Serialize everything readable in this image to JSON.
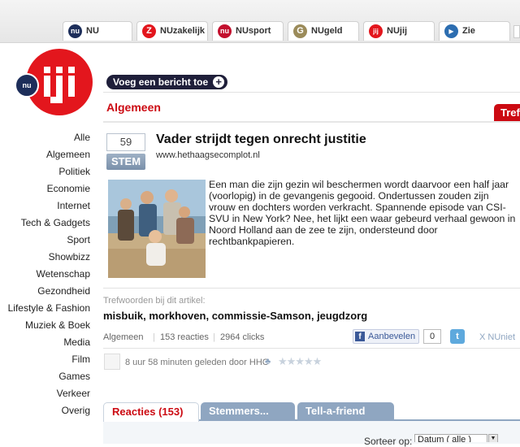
{
  "tabs": [
    {
      "label": "NU",
      "icon": "nu-icon",
      "color": "#1d2e5a",
      "glyph": "nu"
    },
    {
      "label": "NUzakelijk",
      "icon": "z-icon",
      "color": "#e3161d",
      "glyph": "Z"
    },
    {
      "label": "NUsport",
      "icon": "nu-icon",
      "color": "#c3102e",
      "glyph": "nu"
    },
    {
      "label": "NUgeld",
      "icon": "g-icon",
      "color": "#9b8b5a",
      "glyph": "G"
    },
    {
      "label": "NUjij",
      "icon": "jij-icon",
      "color": "#e3161d",
      "glyph": "jij"
    },
    {
      "label": "Zie",
      "icon": "play-icon",
      "color": "#2c6db0",
      "glyph": "▶"
    }
  ],
  "logo": {
    "small": "nu",
    "big": "jij"
  },
  "sidebar": [
    "Alle",
    "Algemeen",
    "Politiek",
    "Economie",
    "Internet",
    "Tech & Gadgets",
    "Sport",
    "Showbizz",
    "Wetenschap",
    "Gezondheid",
    "Lifestyle & Fashion",
    "Muziek & Boek",
    "Media",
    "Film",
    "Games",
    "Verkeer",
    "Overig"
  ],
  "add_button": "Voeg een bericht toe",
  "add_plus": "+",
  "section_title": "Algemeen",
  "tref_tab": "Tref",
  "vote_count": "59",
  "vote_label": "STEM",
  "article": {
    "title": "Vader strijdt tegen onrecht justitie",
    "source": "www.hethaagsecomplot.nl",
    "body": "Een man die zijn gezin wil beschermen wordt daarvoor een half jaar (voorlopig) in de gevangenis gegooid. Ondertussen zouden zijn vrouw en dochters worden verkracht. Spannende episode van CSI-SVU in New York? Nee, het lijkt een waar gebeurd verhaal gewoon in Noord Holland aan de zee te zijn, ondersteund door rechtbankpapieren."
  },
  "tags_label": "Trefwoorden bij dit artikel:",
  "tags": [
    "misbuik",
    "morkhoven",
    "commissie-Samson",
    "jeugdzorg"
  ],
  "tag_sep": ",",
  "meta": {
    "category": "Algemeen",
    "reactions": "153 reacties",
    "clicks": "2964 clicks",
    "like": "Aanbevelen",
    "like_count": "0",
    "xnu": "X NUniet",
    "pipe": "|"
  },
  "posted": {
    "text": "8 uur 58 minuten geleden door HHC",
    "stars": "★★★★★"
  },
  "bottom_tabs": {
    "reacties": "Reacties (153)",
    "stemmers": "Stemmers...",
    "tell": "Tell-a-friend"
  },
  "sort": {
    "label": "Sorteer op:",
    "value": "Datum ( alle )"
  },
  "colors": {
    "red": "#cc0a12",
    "navy": "#1f1f3a",
    "tab_blue": "#8fa6c1"
  }
}
